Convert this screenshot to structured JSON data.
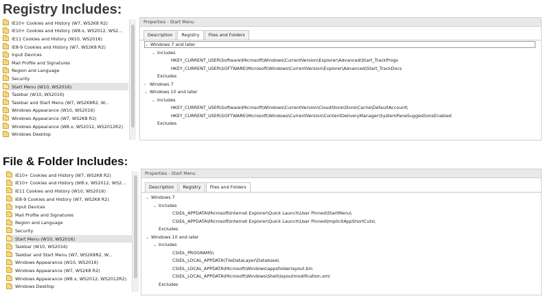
{
  "section1": {
    "heading": "Registry Includes:"
  },
  "section2": {
    "heading": "File & Folder Includes:"
  },
  "list1": [
    {
      "label": "IE10+ Cookies and History (W7, WS2K8 R2)"
    },
    {
      "label": "IE10+ Cookies and History (W8.x, WS2012, WS2..."
    },
    {
      "label": "IE11 Cookies and History (W10, WS2016)"
    },
    {
      "label": "IE8-9 Cookies and History (W7, WS2K8 R2)"
    },
    {
      "label": "Input Devices"
    },
    {
      "label": "Mail Profile and Signatures"
    },
    {
      "label": "Region and Language"
    },
    {
      "label": "Security"
    },
    {
      "label": "Start Menu (W10, WS2016)",
      "selected": true
    },
    {
      "label": "Taskbar (W10, WS2016)"
    },
    {
      "label": "Taskbar and Start Menu (W7, WS2K8R2, W..."
    },
    {
      "label": "Windows Appearance (W10, WS2016)"
    },
    {
      "label": "Windows Appearance (W7, WS2K8 R2)"
    },
    {
      "label": "Windows Appearance (W8.x, WS2012, WS2012R2)"
    },
    {
      "label": "Windows Desktop"
    }
  ],
  "list2": [
    {
      "label": "IE10+ Cookies and History (W7, WS2K8 R2)"
    },
    {
      "label": "IE10+ Cookies and History (W8.x, WS2012, WS2..."
    },
    {
      "label": "IE11 Cookies and History (W10, WS2016)"
    },
    {
      "label": "IE8-9 Cookies and History (W7, WS2K8 R2)"
    },
    {
      "label": "Input Devices"
    },
    {
      "label": "Mail Profile and Signatures"
    },
    {
      "label": "Region and Language"
    },
    {
      "label": "Security"
    },
    {
      "label": "Start Menu (W10, WS2016)",
      "selected": true
    },
    {
      "label": "Taskbar (W10, WS2016)"
    },
    {
      "label": "Taskbar and Start Menu (W7, WS2K8R2, W..."
    },
    {
      "label": "Windows Appearance (W10, WS2016)"
    },
    {
      "label": "Windows Appearance (W7, WS2K8 R2)"
    },
    {
      "label": "Windows Appearance (W8.x, WS2012, WS2012R2)"
    },
    {
      "label": "Windows Desktop"
    }
  ],
  "panel1": {
    "title": "Properties - Start Menu",
    "tabs": [
      "Description",
      "Registry",
      "Files and Folders"
    ],
    "active_tab": 1,
    "tree": [
      {
        "text": "Windows 7 and later",
        "level": 0,
        "chevron": "v",
        "selected": true
      },
      {
        "text": "Includes",
        "level": 1,
        "chevron": "v"
      },
      {
        "text": "HKEY_CURRENT_USER\\Software\\Microsoft\\Windows\\CurrentVersion\\Explorer\\Advanced\\Start_TrackProgs",
        "level": 3
      },
      {
        "text": "HKEY_CURRENT_USER\\SOFTWARE\\Microsoft\\Windows\\CurrentVersion\\Explorer\\Advanced\\Start_TrackDocs",
        "level": 3
      },
      {
        "text": "Excludes",
        "level": 1
      },
      {
        "text": "Windows 7",
        "level": 0,
        "chevron": ">"
      },
      {
        "text": "Windows 10 and later",
        "level": 0,
        "chevron": "v"
      },
      {
        "text": "Includes",
        "level": 1,
        "chevron": "v"
      },
      {
        "text": "HKEY_CURRENT_USER\\Software\\Microsoft\\Windows\\CurrentVersion\\CloudStore\\Store\\Cache\\DefaultAccount\\",
        "level": 3
      },
      {
        "text": "HKEY_CURRENT_USER\\SOFTWARE\\Microsoft\\Windows\\CurrentVersion\\ContentDeliveryManager\\SystemPaneSuggestionsEnabled",
        "level": 3
      },
      {
        "text": "Excludes",
        "level": 1
      }
    ]
  },
  "panel2": {
    "title": "Properties - Start Menu",
    "tabs": [
      "Description",
      "Registry",
      "Files and Folders"
    ],
    "active_tab": 2,
    "tree": [
      {
        "text": "Windows 7",
        "level": 0,
        "chevron": "v"
      },
      {
        "text": "Includes",
        "level": 1,
        "chevron": "v"
      },
      {
        "text": "CSIDL_APPDATA\\Microsoft\\Internet Explorer\\Quick Launch\\User Pinned\\StartMenu\\",
        "level": 3
      },
      {
        "text": "CSIDL_APPDATA\\Microsoft\\Internet Explorer\\Quick Launch\\User Pinned\\ImplicitAppShortCuts\\",
        "level": 3
      },
      {
        "text": "Excludes",
        "level": 1
      },
      {
        "text": "Windows 10 and later",
        "level": 0,
        "chevron": "v"
      },
      {
        "text": "Includes",
        "level": 1,
        "chevron": "v"
      },
      {
        "text": "CSIDL_PROGRAMS\\",
        "level": 3
      },
      {
        "text": "CSIDL_LOCAL_APPDATA\\TileDataLayer\\Database\\",
        "level": 3
      },
      {
        "text": "CSIDL_LOCAL_APPDATA\\Microsoft\\Windows\\appsfolderlayout.bin",
        "level": 3
      },
      {
        "text": "CSIDL_LOCAL_APPDATA\\Microsoft\\Windows\\Shell\\layoutmodification.xml",
        "level": 3
      },
      {
        "text": "Excludes",
        "level": 1
      }
    ]
  },
  "colors": {
    "selected_row": "#e3e3e3",
    "folder": "#f6d77a",
    "header_bg": "#e8e8e8"
  },
  "icons": {
    "list_item": "folder-icon",
    "expand": "chevron-down-icon",
    "collapse": "chevron-right-icon"
  }
}
